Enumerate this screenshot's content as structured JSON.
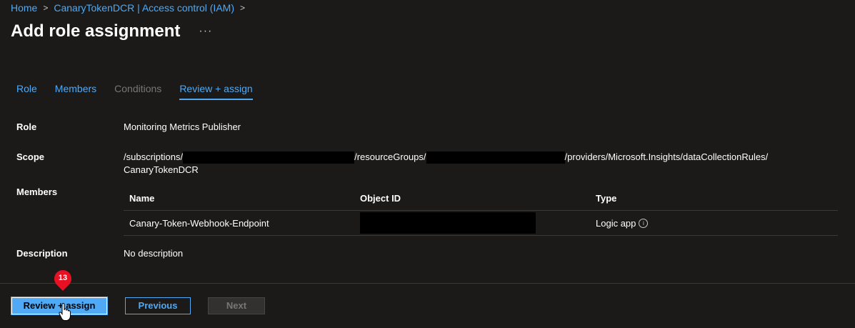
{
  "breadcrumb": {
    "items": [
      "Home",
      "CanaryTokenDCR | Access control (IAM)"
    ],
    "separator": ">"
  },
  "header": {
    "title": "Add role assignment",
    "more": "···"
  },
  "tabs": [
    {
      "label": "Role",
      "state": "link"
    },
    {
      "label": "Members",
      "state": "link"
    },
    {
      "label": "Conditions",
      "state": "disabled"
    },
    {
      "label": "Review + assign",
      "state": "active"
    }
  ],
  "fields": {
    "role": {
      "label": "Role",
      "value": "Monitoring Metrics Publisher"
    },
    "scope": {
      "label": "Scope",
      "part1": "/subscriptions/",
      "part2": "/resourceGroups/",
      "part3": "/providers/Microsoft.Insights/dataCollectionRules/",
      "part4": "CanaryTokenDCR"
    },
    "members": {
      "label": "Members",
      "columns": [
        "Name",
        "Object ID",
        "Type"
      ],
      "rows": [
        {
          "name": "Canary-Token-Webhook-Endpoint",
          "object_id": "",
          "type": "Logic app"
        }
      ]
    },
    "description": {
      "label": "Description",
      "value": "No description"
    }
  },
  "footer": {
    "review_assign": "Review + assign",
    "previous": "Previous",
    "next": "Next"
  },
  "step_marker": {
    "number": "13"
  },
  "colors": {
    "background": "#1b1a19",
    "link": "#4fa9f5",
    "marker": "#e81123"
  }
}
